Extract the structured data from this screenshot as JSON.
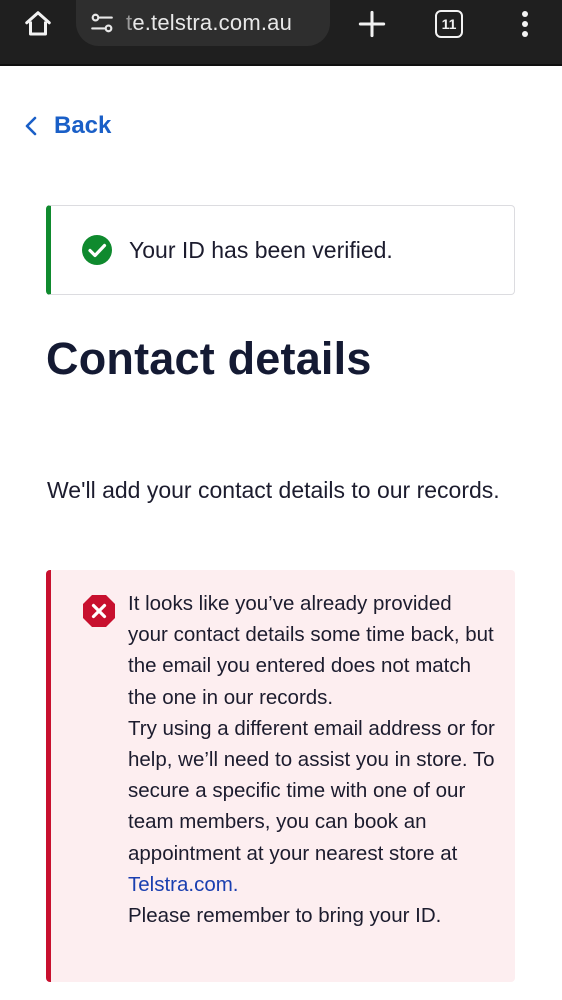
{
  "browser": {
    "url_faded": "t",
    "url_main": "e.telstra.com.au",
    "tab_count": "11"
  },
  "back": {
    "label": "Back"
  },
  "success": {
    "message": "Your ID has been verified."
  },
  "page": {
    "title": "Contact details",
    "intro": "We'll add your contact details to our records."
  },
  "error": {
    "line1": "It looks like you’ve already provided your contact details some time back, but the email you entered does not match the one in our records.",
    "line2_before": "Try using a different email address or for help, we’ll need to assist you in store. To secure a specific time with one of our team members, you can book an appointment at your nearest store at",
    "link_text": "Telstra.com.",
    "line3": "Please remember to bring your ID."
  },
  "colors": {
    "accent_blue": "#1a5fc7",
    "success_green": "#0f8a2e",
    "error_red": "#c8102e",
    "error_bg": "#fdeef0"
  },
  "icons": {
    "home": "home-icon",
    "site_settings": "tune-icon",
    "new_tab": "plus-icon",
    "tabs": "tab-switcher-icon",
    "menu": "more-vert-icon",
    "back": "chevron-left-icon",
    "success": "check-circle-icon",
    "error": "error-octagon-icon"
  }
}
